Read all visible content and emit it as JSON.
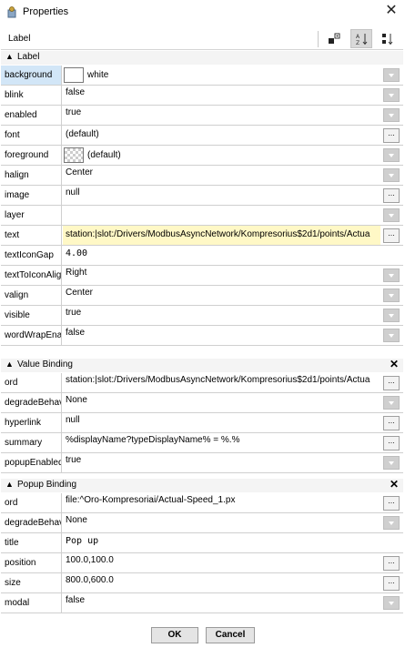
{
  "window": {
    "title": "Properties",
    "icon": "properties-icon",
    "close_glyph": "✕"
  },
  "header": {
    "label": "Label",
    "tools": [
      {
        "name": "expand-slots-icon",
        "active": false
      },
      {
        "name": "sort-az-icon",
        "active": true
      },
      {
        "name": "sort-order-icon",
        "active": false
      }
    ]
  },
  "sections": {
    "label": {
      "title": "Label",
      "collapse_glyph": "⯭"
    },
    "value_binding": {
      "title": "Value Binding",
      "close_glyph": "✕"
    },
    "popup_binding": {
      "title": "Popup Binding",
      "close_glyph": "✕"
    }
  },
  "label_props": [
    {
      "name": "background",
      "value": "white"
    },
    {
      "name": "blink",
      "value": "false"
    },
    {
      "name": "enabled",
      "value": "true"
    },
    {
      "name": "font",
      "value": "(default)"
    },
    {
      "name": "foreground",
      "value": "(default)"
    },
    {
      "name": "halign",
      "value": "Center"
    },
    {
      "name": "image",
      "value": "null"
    },
    {
      "name": "layer",
      "value": ""
    },
    {
      "name": "text",
      "value": "station:|slot:/Drivers/ModbusAsyncNetwork/Kompresorius$2d1/points/Actua"
    },
    {
      "name": "textIconGap",
      "value": "4.00"
    },
    {
      "name": "textToIconAlig",
      "value": "Right"
    },
    {
      "name": "valign",
      "value": "Center"
    },
    {
      "name": "visible",
      "value": "true"
    },
    {
      "name": "wordWrapEna",
      "value": "false"
    }
  ],
  "value_binding_props": [
    {
      "name": "ord",
      "value": "station:|slot:/Drivers/ModbusAsyncNetwork/Kompresorius$2d1/points/Actua"
    },
    {
      "name": "degradeBehav",
      "value": "None"
    },
    {
      "name": "hyperlink",
      "value": "null"
    },
    {
      "name": "summary",
      "value": "%displayName?typeDisplayName% = %.%"
    },
    {
      "name": "popupEnabled",
      "value": "true"
    }
  ],
  "popup_binding_props": [
    {
      "name": "ord",
      "value": "file:^Oro-Kompresoriai/Actual-Speed_1.px"
    },
    {
      "name": "degradeBehav",
      "value": "None"
    },
    {
      "name": "title",
      "value": "Pop up"
    },
    {
      "name": "position",
      "value": "100.0,100.0"
    },
    {
      "name": "size",
      "value": "800.0,600.0"
    },
    {
      "name": "modal",
      "value": "false"
    }
  ],
  "footer": {
    "ok_label": "OK",
    "cancel_label": "Cancel"
  },
  "editor_glyph": "...",
  "colors": {
    "selected_row": "#d2e6f7",
    "highlight_value": "#fff8c6",
    "dropdown_button": "#cfcfcf"
  }
}
